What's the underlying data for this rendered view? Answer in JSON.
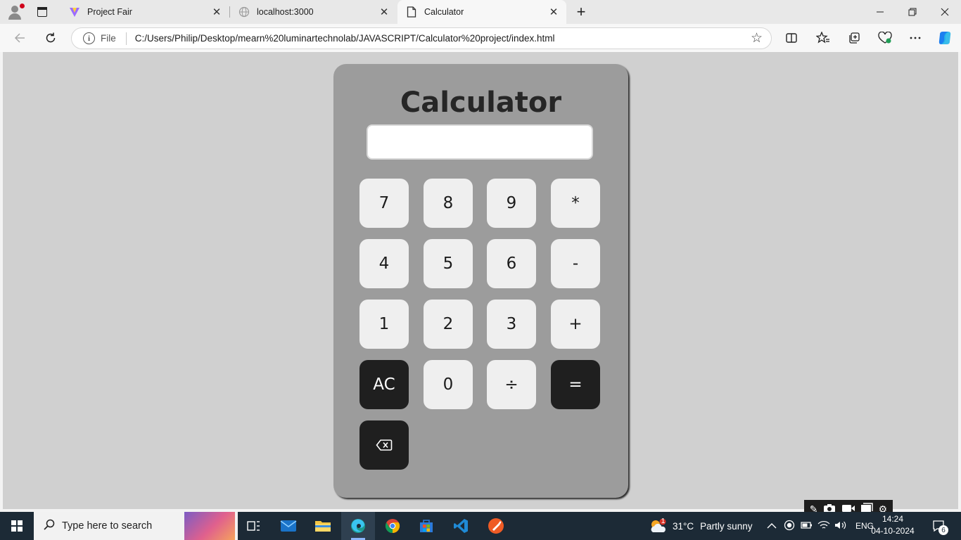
{
  "browser": {
    "tabs": [
      {
        "title": "Project Fair",
        "favicon": "vite-logo-icon"
      },
      {
        "title": "localhost:3000",
        "favicon": "globe-icon"
      },
      {
        "title": "Calculator",
        "favicon": "document-icon",
        "active": true
      }
    ],
    "address": {
      "scheme_label": "File",
      "url": "C:/Users/Philip/Desktop/mearn%20luminartechnolab/JAVASCRIPT/Calculator%20project/index.html"
    },
    "new_tab_glyph": "+",
    "close_glyph": "✕",
    "window_controls": {
      "minimize": "—",
      "maximize": "❐",
      "close": "✕"
    }
  },
  "calculator": {
    "title": "Calculator",
    "display_value": "",
    "keys": [
      {
        "label": "7",
        "style": "light"
      },
      {
        "label": "8",
        "style": "light"
      },
      {
        "label": "9",
        "style": "light"
      },
      {
        "label": "*",
        "style": "light"
      },
      {
        "label": "4",
        "style": "light"
      },
      {
        "label": "5",
        "style": "light"
      },
      {
        "label": "6",
        "style": "light"
      },
      {
        "label": "-",
        "style": "light"
      },
      {
        "label": "1",
        "style": "light"
      },
      {
        "label": "2",
        "style": "light"
      },
      {
        "label": "3",
        "style": "light"
      },
      {
        "label": "+",
        "style": "light"
      },
      {
        "label": "AC",
        "style": "dark"
      },
      {
        "label": "0",
        "style": "light"
      },
      {
        "label": "÷",
        "style": "light"
      },
      {
        "label": "=",
        "style": "dark"
      },
      {
        "label": "⌫",
        "style": "dark"
      }
    ]
  },
  "taskbar": {
    "search_placeholder": "Type here to search",
    "weather": {
      "temperature": "31°C",
      "condition": "Partly sunny",
      "alert_count": "1"
    },
    "language": "ENG",
    "time": "14:24",
    "date": "04-10-2024",
    "notification_count": "6"
  },
  "colors": {
    "page_background": "#d0d0d0",
    "calculator_body": "#9c9c9c",
    "key_light": "#efefef",
    "key_dark": "#1f1f1f",
    "taskbar": "#1c2a36"
  }
}
